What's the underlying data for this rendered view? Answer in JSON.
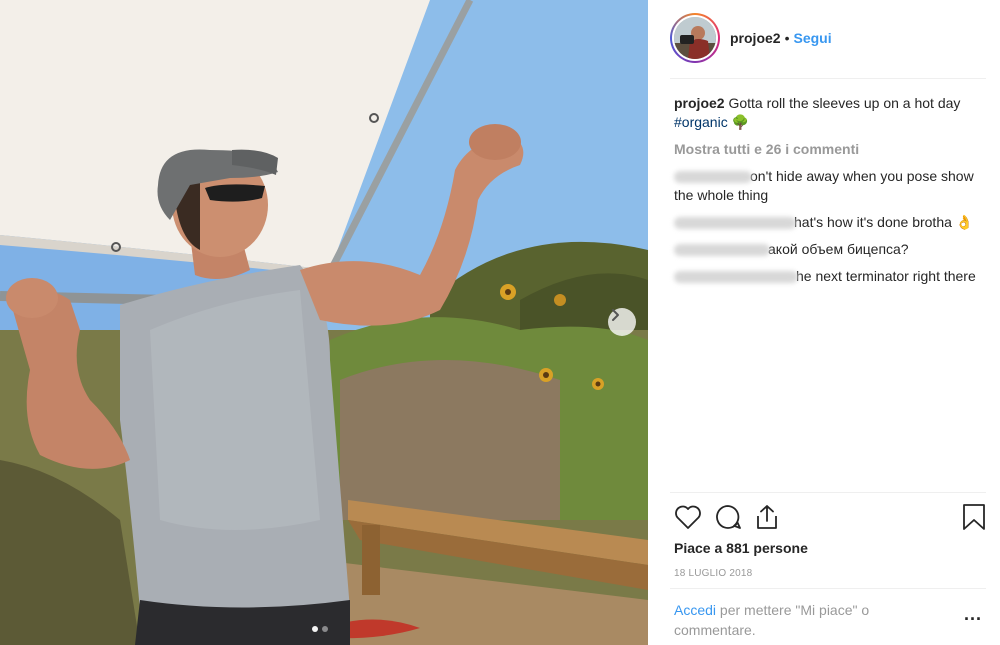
{
  "post": {
    "username": "projoe2",
    "follow_label": "Segui",
    "separator": "•",
    "caption_text": "Gotta roll the sleeves up on a hot day",
    "caption_hashtag": "#organic",
    "caption_emoji": "🌳",
    "view_all_comments": "Mostra tutti e 26 i commenti",
    "comments": [
      {
        "text": "on't hide away when you pose show the whole thing"
      },
      {
        "text": "hat's how it's done brotha 👌"
      },
      {
        "text": "акой объем бицепса?"
      },
      {
        "text": "he next terminator right there"
      }
    ],
    "likes": "Piace a 881 persone",
    "date": "18 LUGLIO 2018",
    "login_link": "Accedi",
    "login_rest": "per mettere \"Mi piace\" o commentare.",
    "more_label": "...",
    "carousel_total": 2,
    "carousel_active": 0
  },
  "icons": {
    "like": "heart-icon",
    "comment": "comment-icon",
    "share": "share-icon",
    "save": "bookmark-icon",
    "next": "chevron-right-icon"
  },
  "colors": {
    "link": "#3897f0",
    "hashtag": "#003569",
    "muted": "#999999",
    "text": "#262626"
  }
}
